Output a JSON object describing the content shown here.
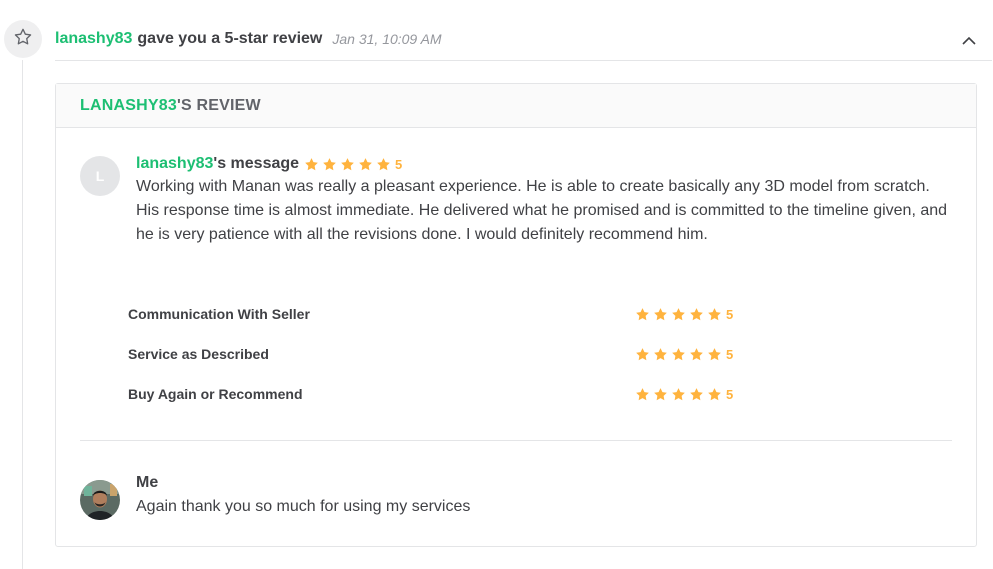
{
  "colors": {
    "accent_green": "#1dbf73",
    "star_orange": "#ffb33e",
    "text": "#404145",
    "muted": "#95979d"
  },
  "icons": {
    "badge": "star-outline-icon",
    "collapse": "chevron-up-icon",
    "rating": "star-icon"
  },
  "header": {
    "username": "lanashy83",
    "action_text": "gave you a 5-star review",
    "timestamp": "Jan 31, 10:09 AM"
  },
  "review": {
    "title_user": "LANASHY83",
    "title_suffix": "'S REVIEW",
    "buyer_initial": "L",
    "buyer_name": "lanashy83",
    "message_suffix": "'s message",
    "overall_rating": 5,
    "overall_score": "5",
    "message": "Working with Manan was really a pleasant experience. He is able to create basically any 3D model from scratch. His response time is almost immediate. He delivered what he promised and is committed to the timeline given, and he is very patience with all the revisions done. I would definitely recommend him.",
    "criteria": [
      {
        "label": "Communication With Seller",
        "rating": 5,
        "score": "5"
      },
      {
        "label": "Service as Described",
        "rating": 5,
        "score": "5"
      },
      {
        "label": "Buy Again or Recommend",
        "rating": 5,
        "score": "5"
      }
    ]
  },
  "reply": {
    "author": "Me",
    "text": "Again thank you so much for using my services"
  }
}
